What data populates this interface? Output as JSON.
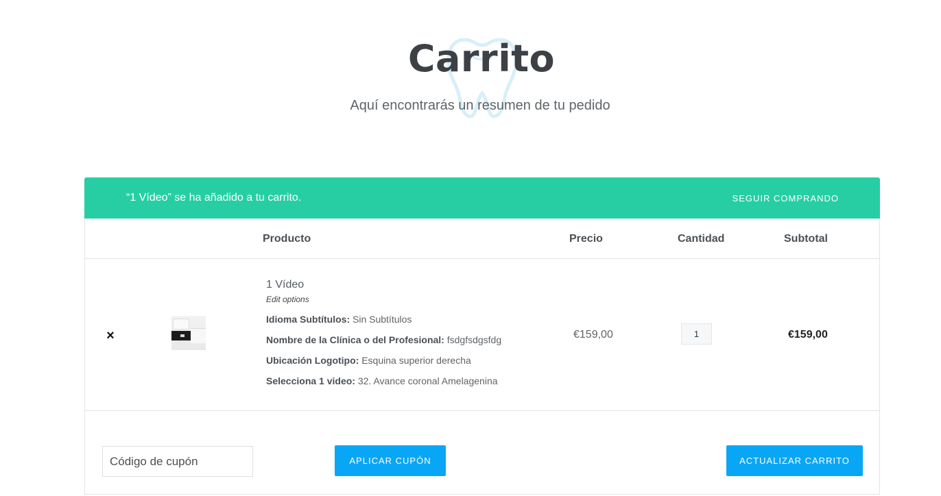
{
  "header": {
    "title": "Carrito",
    "subtitle": "Aquí encontrarás un resumen de tu pedido"
  },
  "notice": {
    "message": "“1 Vídeo” se ha añadido a tu carrito.",
    "link_label": "SEGUIR COMPRANDO",
    "background_color": "#27cea4"
  },
  "table": {
    "columns": {
      "product": "Producto",
      "price": "Precio",
      "quantity": "Cantidad",
      "subtotal": "Subtotal"
    },
    "rows": [
      {
        "remove_icon": "×",
        "name": "1 Vídeo",
        "edit_label": "Edit options",
        "meta": [
          {
            "label": "Idioma Subtítulos:",
            "value": "Sin Subtítulos"
          },
          {
            "label": "Nombre de la Clínica o del Profesional:",
            "value": "fsdgfsdgsfdg"
          },
          {
            "label": "Ubicación Logotipo:",
            "value": "Esquina superior derecha"
          },
          {
            "label": "Selecciona 1 video:",
            "value": "32. Avance coronal Amelagenina"
          }
        ],
        "price": "€159,00",
        "quantity": "1",
        "subtotal": "€159,00"
      }
    ]
  },
  "actions": {
    "coupon_placeholder": "Código de cupón",
    "apply_label": "APLICAR CUPÓN",
    "update_label": "ACTUALIZAR CARRITO",
    "button_color": "#0aa6f6"
  }
}
